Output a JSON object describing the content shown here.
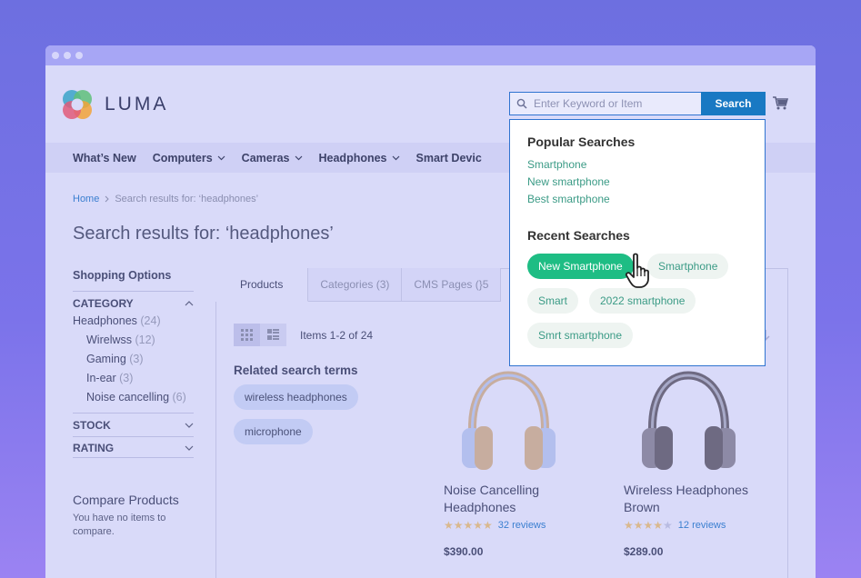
{
  "app": {
    "logo_text": "LUMA"
  },
  "search": {
    "placeholder": "Enter Keyword or Item",
    "button_label": "Search"
  },
  "nav": {
    "items": [
      {
        "label": "What’s New",
        "has_dropdown": false
      },
      {
        "label": "Computers",
        "has_dropdown": true
      },
      {
        "label": "Cameras",
        "has_dropdown": true
      },
      {
        "label": "Headphones",
        "has_dropdown": true
      },
      {
        "label": "Smart Devic",
        "has_dropdown": false
      }
    ]
  },
  "breadcrumb": {
    "home": "Home",
    "current": "Search results for: ‘headphones’"
  },
  "page": {
    "title": "Search results for: ‘headphones’"
  },
  "sidebar": {
    "heading": "Shopping Options",
    "category": {
      "label": "CATEGORY",
      "options": [
        {
          "label": "Headphones",
          "count": "(24)"
        },
        {
          "label": "Wirelwss",
          "count": "(12)"
        },
        {
          "label": "Gaming",
          "count": "(3)"
        },
        {
          "label": "In-ear",
          "count": "(3)"
        },
        {
          "label": "Noise cancelling",
          "count": "(6)"
        }
      ]
    },
    "stock_label": "STOCK",
    "rating_label": "RATING",
    "compare_title": "Compare Products",
    "compare_text": "You have no items to compare."
  },
  "tabs": [
    {
      "label": "Products",
      "active": true
    },
    {
      "label": "Categories (3)",
      "active": false
    },
    {
      "label": "CMS Pages (}5",
      "active": false
    }
  ],
  "results": {
    "items_count": "Items 1-2 of 24",
    "related_title": "Related search terms",
    "related_terms": [
      "wireless headphones",
      "microphone"
    ]
  },
  "products": [
    {
      "name": "Noise Cancelling Headphones",
      "rating": 5,
      "reviews": "32 reviews",
      "price": "$390.00",
      "color": "#c7ad9f"
    },
    {
      "name": "Wireless Headphones Brown",
      "rating": 4,
      "reviews": "12 reviews",
      "price": "$289.00",
      "color": "#6e6a82"
    }
  ],
  "dropdown": {
    "popular_title": "Popular Searches",
    "popular": [
      "Smartphone",
      "New smartphone",
      "Best smartphone"
    ],
    "recent_title": "Recent Searches",
    "recent": [
      "New Smartphone",
      "Smartphone",
      "Smart",
      "2022 smartphone",
      "Smrt smartphone"
    ]
  },
  "colors": {
    "accent": "#1979c3",
    "chip_active": "#1ebd84",
    "link_green": "#3b9b86"
  }
}
